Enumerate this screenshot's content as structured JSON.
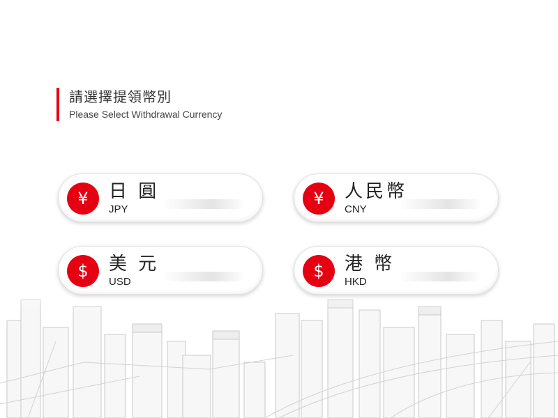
{
  "header": {
    "title_zh": "請選擇提領幣別",
    "title_en": "Please Select Withdrawal Currency"
  },
  "accent_color": "#e50012",
  "currencies": [
    {
      "symbol": "¥",
      "name_zh": "日 圓",
      "code": "JPY",
      "icon": "yen-icon"
    },
    {
      "symbol": "¥",
      "name_zh": "人民幣",
      "code": "CNY",
      "icon": "yuan-icon"
    },
    {
      "symbol": "$",
      "name_zh": "美 元",
      "code": "USD",
      "icon": "dollar-icon"
    },
    {
      "symbol": "$",
      "name_zh": "港 幣",
      "code": "HKD",
      "icon": "dollar-icon"
    }
  ]
}
